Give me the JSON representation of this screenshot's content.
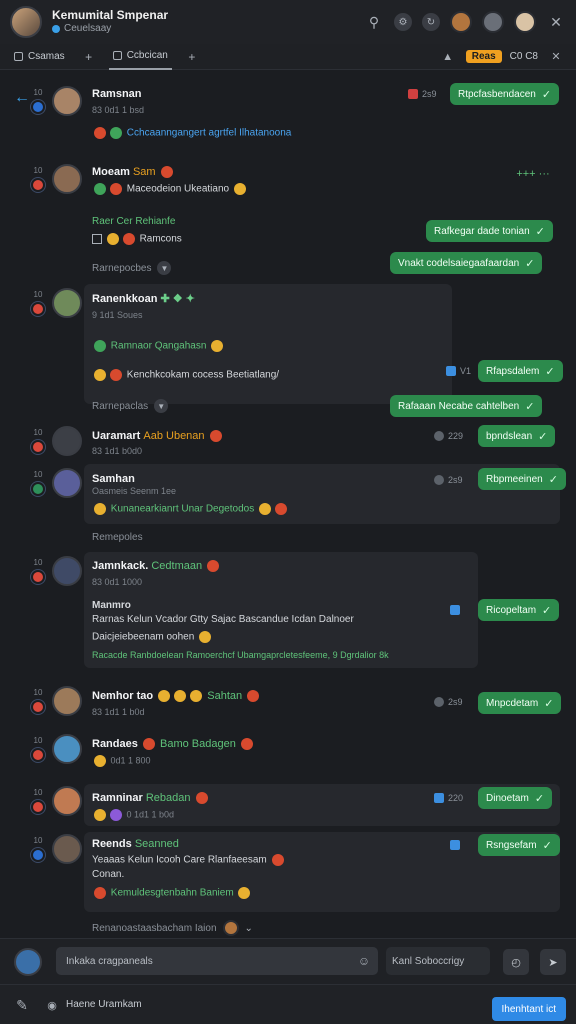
{
  "header": {
    "title": "Kemumital Smpenar",
    "subtitle": "Ceuelsaay"
  },
  "tabs": [
    {
      "label": "Csamas"
    },
    {
      "label": "Ccbcican"
    }
  ],
  "tab_right": {
    "badge": "Reas",
    "count": "C0 C8"
  },
  "rows": [
    {
      "name": "Ramsnan",
      "meta": "83 0d1 1 bsd",
      "msg": "Cchcaanngangert agrtfel Ilhatanoona",
      "time": "2s9",
      "bubble": "Rtpcfasbendacen"
    },
    {
      "name": "Moeam",
      "tag": "Sam",
      "msg": "Maceodeion Ukeatiano",
      "bubble": "Rafkegar dade tonian"
    },
    {
      "name": "Raer Cer Rehianfe",
      "msg": "Ramcons",
      "bubble": "Vnakt codelsaiegaafaardan"
    },
    {
      "section": "Rarnepocbes"
    },
    {
      "name": "Ranenkkoan",
      "meta": "9 1d1  Soues",
      "msg": "Ramnaor Qangahasn",
      "msg2": "Kenchkcokam cocess Beetiatlang/",
      "time": "V1",
      "bubble": "Rfapsdalem"
    },
    {
      "section": "Rarnepaclas",
      "bubble": "Rafaaan Necabe cahtelben"
    },
    {
      "name": "Uaramart",
      "tag": "Aab Ubenan",
      "meta": "83 1d1  b0d0",
      "time": "229",
      "bubble": "bpndslean"
    },
    {
      "name": "Samhan",
      "meta": "Oasmeis  Seenm 1ee",
      "msg": "Kunanearkianrt Unar Degetodos",
      "time": "2s9",
      "bubble": "Rbpmeeinen"
    },
    {
      "section": "Remepoles"
    },
    {
      "name": "Jamnkack.",
      "tag": "Cedtmaan",
      "meta": "83 0d1  1000",
      "head": "Manmro",
      "msg": "Rarnas  Kelun Vcador Gtty  Sajac Bascandue Icdan Dalnoer",
      "msg2": "Daicjeiebeenam oohen",
      "msg3": "Racacde Ranbdoelean Ramoerchcf Ubamgaprcletesfeeme, 9 Dgrdalior 8k",
      "bubble": "Ricopeltam"
    },
    {
      "name": "Nemhor tao",
      "tag": "Sahtan",
      "meta": "83 1d1  1 b0d",
      "time": "2s9",
      "bubble": "Mnpcdetam"
    },
    {
      "name": "Randaes",
      "tag": "Bamo   Badagen",
      "meta": "0d1  1 800",
      "bubble": ""
    },
    {
      "name": "Ramninar",
      "tag": "Rebadan",
      "meta": "0 1d1  1 b0d",
      "time": "220",
      "bubble": "Dinoetam"
    },
    {
      "name": "Reends",
      "tag": "Seanned",
      "head": "Yeaaas  Kelun Icooh  Care Rlanfaeesam",
      "msg": "Conan.",
      "msg2": "Kemuldesgtenbahn  Baniem",
      "bubble": "Rsngsefam"
    }
  ],
  "footer_section": "Renanoastaasbacham Iaion",
  "composer": {
    "placeholder": "Inkaka cragpaneals",
    "second": "Kanl Soboccrigy"
  },
  "bottom": {
    "label": "Haene Uramkam",
    "button": "Ihenhtant ict"
  }
}
